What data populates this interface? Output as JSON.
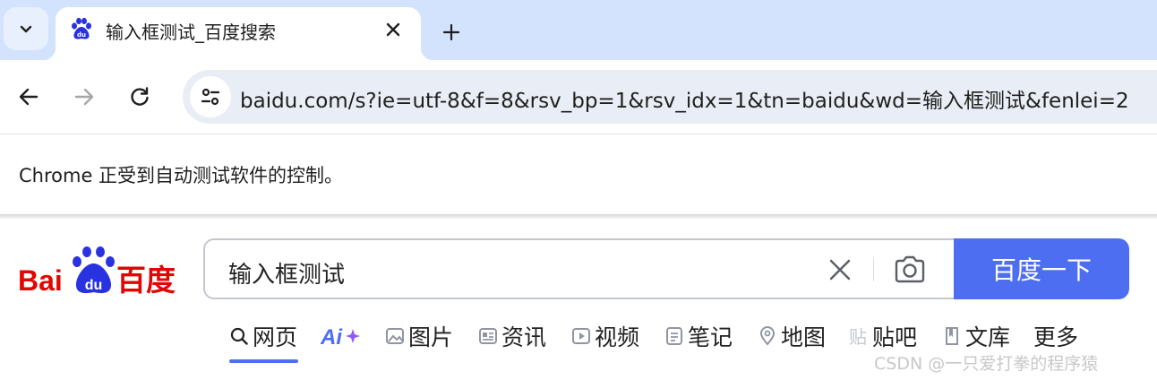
{
  "browser": {
    "tab": {
      "title": "输入框测试_百度搜索"
    },
    "url": "baidu.com/s?ie=utf-8&f=8&rsv_bp=1&rsv_idx=1&tn=baidu&wd=输入框测试&fenlei=2",
    "infobar_text": "Chrome 正受到自动测试软件的控制。"
  },
  "baidu": {
    "query": "输入框测试",
    "search_button": "百度一下",
    "tabs": [
      {
        "label": "网页",
        "icon": "search-icon"
      },
      {
        "label": "",
        "icon": "ai-plus-icon"
      },
      {
        "label": "图片",
        "icon": "image-icon"
      },
      {
        "label": "资讯",
        "icon": "news-icon"
      },
      {
        "label": "视频",
        "icon": "video-icon"
      },
      {
        "label": "笔记",
        "icon": "note-icon"
      },
      {
        "label": "地图",
        "icon": "map-icon"
      },
      {
        "label": "贴吧",
        "icon": "tieba-icon"
      },
      {
        "label": "文库",
        "icon": "library-icon"
      },
      {
        "label": "更多",
        "icon": ""
      }
    ],
    "accent_color": "#4e6ef2"
  },
  "watermark": "CSDN @一只爱打拳的程序猿"
}
